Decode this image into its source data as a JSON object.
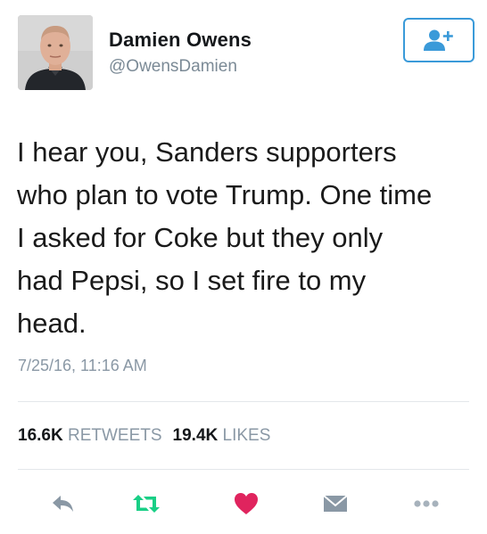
{
  "user": {
    "display_name": "Damien Owens",
    "handle": "@OwensDamien"
  },
  "follow_button": {
    "icon": "add-user-icon"
  },
  "tweet": {
    "lines": [
      "I hear you, Sanders supporters",
      "who plan to vote Trump. One time",
      "I asked for Coke but they only",
      "had Pepsi, so I set fire to my",
      "head."
    ],
    "timestamp": "7/25/16, 11:16 AM"
  },
  "stats": {
    "retweets_count": "16.6K",
    "retweets_label": "RETWEETS",
    "likes_count": "19.4K",
    "likes_label": "LIKES"
  },
  "actions": {
    "reply_icon": "reply-icon",
    "retweet_icon": "retweet-icon",
    "like_icon": "heart-icon",
    "dm_icon": "envelope-icon",
    "more_icon": "more-dots-icon"
  },
  "colors": {
    "accent": "#3a9ad9",
    "retweet_green": "#19cf86",
    "like_red": "#e0245e",
    "muted_icon": "#8a98a5"
  }
}
